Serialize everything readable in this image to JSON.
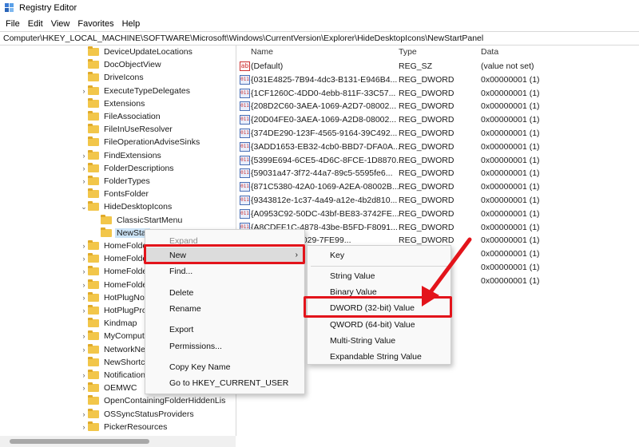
{
  "window": {
    "title": "Registry Editor"
  },
  "menubar": [
    "File",
    "Edit",
    "View",
    "Favorites",
    "Help"
  ],
  "address": "Computer\\HKEY_LOCAL_MACHINE\\SOFTWARE\\Microsoft\\Windows\\CurrentVersion\\Explorer\\HideDesktopIcons\\NewStartPanel",
  "tree": [
    {
      "label": "DeviceUpdateLocations",
      "chevron": "",
      "indent": 0
    },
    {
      "label": "DocObjectView",
      "chevron": "",
      "indent": 0
    },
    {
      "label": "DriveIcons",
      "chevron": "",
      "indent": 0
    },
    {
      "label": "ExecuteTypeDelegates",
      "chevron": "›",
      "indent": 0
    },
    {
      "label": "Extensions",
      "chevron": "",
      "indent": 0
    },
    {
      "label": "FileAssociation",
      "chevron": "",
      "indent": 0
    },
    {
      "label": "FileInUseResolver",
      "chevron": "",
      "indent": 0
    },
    {
      "label": "FileOperationAdviseSinks",
      "chevron": "",
      "indent": 0
    },
    {
      "label": "FindExtensions",
      "chevron": "›",
      "indent": 0
    },
    {
      "label": "FolderDescriptions",
      "chevron": "›",
      "indent": 0
    },
    {
      "label": "FolderTypes",
      "chevron": "›",
      "indent": 0
    },
    {
      "label": "FontsFolder",
      "chevron": "",
      "indent": 0
    },
    {
      "label": "HideDesktopIcons",
      "chevron": "⌄",
      "indent": 0
    },
    {
      "label": "ClassicStartMenu",
      "chevron": "",
      "indent": 1
    },
    {
      "label": "NewStar",
      "chevron": "",
      "indent": 1,
      "selected": true
    },
    {
      "label": "HomeFolde",
      "chevron": "›",
      "indent": 0
    },
    {
      "label": "HomeFolde",
      "chevron": "›",
      "indent": 0
    },
    {
      "label": "HomeFolde",
      "chevron": "›",
      "indent": 0
    },
    {
      "label": "HomeFolde",
      "chevron": "›",
      "indent": 0
    },
    {
      "label": "HotPlugNo",
      "chevron": "›",
      "indent": 0
    },
    {
      "label": "HotPlugPro",
      "chevron": "›",
      "indent": 0
    },
    {
      "label": "Kindmap",
      "chevron": "",
      "indent": 0
    },
    {
      "label": "MyComput",
      "chevron": "›",
      "indent": 0
    },
    {
      "label": "NetworkNe",
      "chevron": "›",
      "indent": 0
    },
    {
      "label": "NewShortc",
      "chevron": "",
      "indent": 0
    },
    {
      "label": "Notification",
      "chevron": "›",
      "indent": 0
    },
    {
      "label": "OEMWC",
      "chevron": "›",
      "indent": 0
    },
    {
      "label": "OpenContainingFolderHiddenLis",
      "chevron": "",
      "indent": 0
    },
    {
      "label": "OSSyncStatusProviders",
      "chevron": "›",
      "indent": 0
    },
    {
      "label": "PickerResources",
      "chevron": "›",
      "indent": 0
    }
  ],
  "values_header": {
    "name": "Name",
    "type": "Type",
    "data": "Data"
  },
  "values": [
    {
      "icon": "ab",
      "name": "(Default)",
      "type": "REG_SZ",
      "data": "(value not set)"
    },
    {
      "icon": "011",
      "name": "{031E4825-7B94-4dc3-B131-E946B4...",
      "type": "REG_DWORD",
      "data": "0x00000001 (1)"
    },
    {
      "icon": "011",
      "name": "{1CF1260C-4DD0-4ebb-811F-33C57...",
      "type": "REG_DWORD",
      "data": "0x00000001 (1)"
    },
    {
      "icon": "011",
      "name": "{208D2C60-3AEA-1069-A2D7-08002...",
      "type": "REG_DWORD",
      "data": "0x00000001 (1)"
    },
    {
      "icon": "011",
      "name": "{20D04FE0-3AEA-1069-A2D8-08002...",
      "type": "REG_DWORD",
      "data": "0x00000001 (1)"
    },
    {
      "icon": "011",
      "name": "{374DE290-123F-4565-9164-39C492...",
      "type": "REG_DWORD",
      "data": "0x00000001 (1)"
    },
    {
      "icon": "011",
      "name": "{3ADD1653-EB32-4cb0-BBD7-DFA0A...",
      "type": "REG_DWORD",
      "data": "0x00000001 (1)"
    },
    {
      "icon": "011",
      "name": "{5399E694-6CE5-4D6C-8FCE-1D8870...",
      "type": "REG_DWORD",
      "data": "0x00000001 (1)"
    },
    {
      "icon": "011",
      "name": "{59031a47-3f72-44a7-89c5-5595fe6...",
      "type": "REG_DWORD",
      "data": "0x00000001 (1)"
    },
    {
      "icon": "011",
      "name": "{871C5380-42A0-1069-A2EA-08002B...",
      "type": "REG_DWORD",
      "data": "0x00000001 (1)"
    },
    {
      "icon": "011",
      "name": "{9343812e-1c37-4a49-a12e-4b2d810...",
      "type": "REG_DWORD",
      "data": "0x00000001 (1)"
    },
    {
      "icon": "011",
      "name": "{A0953C92-50DC-43bf-BE83-3742FE...",
      "type": "REG_DWORD",
      "data": "0x00000001 (1)"
    },
    {
      "icon": "011",
      "name": "{A8CDFF1C-4878-43be-B5FD-F8091...",
      "type": "REG_DWORD",
      "data": "0x00000001 (1)"
    },
    {
      "icon": "011",
      "name": "{...2C-424C-B029-7FE99...",
      "type": "REG_DWORD",
      "data": "0x00000001 (1)"
    },
    {
      "icon": "",
      "name": "",
      "type": "",
      "data": "0x00000001 (1)"
    },
    {
      "icon": "",
      "name": "",
      "type": "",
      "data": "0x00000001 (1)"
    },
    {
      "icon": "",
      "name": "",
      "type": "",
      "data": "0x00000001 (1)"
    }
  ],
  "context_menu": {
    "items": [
      {
        "label": "Expand",
        "disabled": true
      },
      {
        "label": "New",
        "submenu": true,
        "active": true
      },
      {
        "label": "Find..."
      },
      {
        "label": "Delete"
      },
      {
        "label": "Rename"
      },
      {
        "label": "Export"
      },
      {
        "label": "Permissions..."
      },
      {
        "label": "Copy Key Name"
      },
      {
        "label": "Go to HKEY_CURRENT_USER"
      }
    ],
    "submenu_arrow": "›"
  },
  "submenu": {
    "items": [
      "Key",
      "String Value",
      "Binary Value",
      "DWORD (32-bit) Value",
      "QWORD (64-bit) Value",
      "Multi-String Value",
      "Expandable String Value"
    ]
  },
  "colors": {
    "highlight": "#e3141b",
    "selection": "#cce4f7",
    "folder": "#f2c64a"
  }
}
